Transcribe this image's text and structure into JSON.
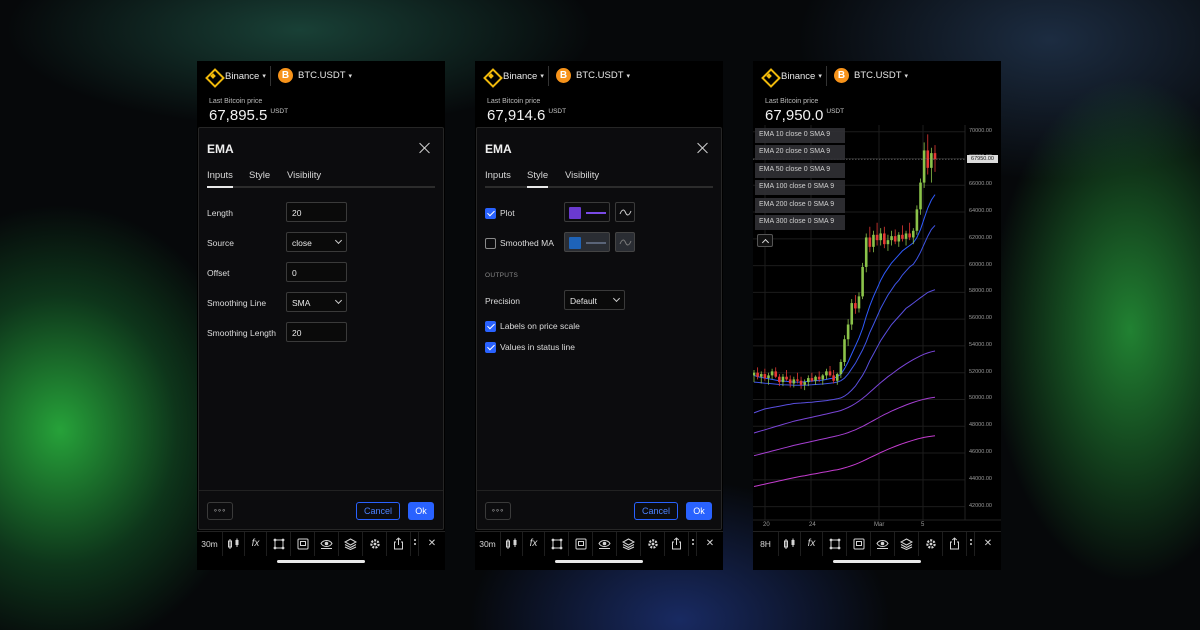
{
  "common": {
    "exchange": "Binance",
    "pair": "BTC.USDT",
    "btc_symbol": "B",
    "price_label": "Last Bitcoin price",
    "price_unit": "USDT",
    "caret": "▾"
  },
  "phones": [
    {
      "price": "67,895.5",
      "interval": "30m",
      "dialog": {
        "title": "EMA",
        "tabs": [
          "Inputs",
          "Style",
          "Visibility"
        ],
        "active_tab": "Inputs",
        "inputs": [
          {
            "label": "Length",
            "value": "20",
            "type": "number"
          },
          {
            "label": "Source",
            "value": "close",
            "type": "select"
          },
          {
            "label": "Offset",
            "value": "0",
            "type": "number"
          },
          {
            "label": "Smoothing Line",
            "value": "SMA",
            "type": "select"
          },
          {
            "label": "Smoothing Length",
            "value": "20",
            "type": "number"
          }
        ],
        "more_label": "◦◦◦",
        "cancel_label": "Cancel",
        "ok_label": "Ok"
      }
    },
    {
      "price": "67,914.6",
      "interval": "30m",
      "dialog": {
        "title": "EMA",
        "tabs": [
          "Inputs",
          "Style",
          "Visibility"
        ],
        "active_tab": "Style",
        "plot": {
          "label": "Plot",
          "checked": true,
          "color": "#6a3ad0",
          "line_color": "#7a4ae6"
        },
        "smoothed": {
          "label": "Smoothed MA",
          "checked": false,
          "color": "#1e63b8",
          "line_color": "#5a6478"
        },
        "outputs_caption": "OUTPUTS",
        "precision_label": "Precision",
        "precision_value": "Default",
        "labels_on_scale": "Labels on price scale",
        "values_in_status": "Values in status line",
        "more_label": "◦◦◦",
        "cancel_label": "Cancel",
        "ok_label": "Ok"
      }
    },
    {
      "price": "67,950.0",
      "interval": "8H",
      "legend": [
        "EMA 10 close 0 SMA 9",
        "EMA 20 close 0 SMA 9",
        "EMA 50 close 0 SMA 9",
        "EMA 100 close 0 SMA 9",
        "EMA 200 close 0 SMA 9",
        "EMA 300 close 0 SMA 9"
      ],
      "current_price_tag": "67950.00"
    }
  ],
  "toolbar": {
    "fx_label": "fx",
    "close_label": "✕"
  },
  "colors": {
    "accent": "#2962ff",
    "up_candle": "#8bc34a",
    "down_candle": "#e53935",
    "ema_colors": [
      "#2f5bff",
      "#3f55e8",
      "#5a4fe0",
      "#7a45d8",
      "#a63fd2",
      "#c43ccf"
    ]
  },
  "chart_data": {
    "type": "candlestick",
    "y_ticks": [
      "70000.00",
      "68000.00",
      "66000.00",
      "64000.00",
      "62000.00",
      "60000.00",
      "58000.00",
      "56000.00",
      "54000.00",
      "52000.00",
      "50000.00",
      "48000.00",
      "46000.00",
      "44000.00",
      "42000.00"
    ],
    "ylim": [
      41000,
      70500
    ],
    "x_ticks": [
      "20",
      "24",
      "Mar",
      "5"
    ],
    "grid": true,
    "candles": [
      [
        51800,
        52200,
        51300,
        52000
      ],
      [
        52000,
        52400,
        51500,
        51700
      ],
      [
        51700,
        52100,
        51200,
        51900
      ],
      [
        51900,
        52300,
        51400,
        51600
      ],
      [
        51600,
        52000,
        51100,
        51800
      ],
      [
        51800,
        52300,
        51500,
        52100
      ],
      [
        52100,
        52400,
        51600,
        51700
      ],
      [
        51700,
        51900,
        51000,
        51300
      ],
      [
        51300,
        51900,
        51000,
        51700
      ],
      [
        51700,
        52200,
        51400,
        51500
      ],
      [
        51500,
        51800,
        50900,
        51200
      ],
      [
        51200,
        51700,
        50900,
        51500
      ],
      [
        51500,
        52000,
        51200,
        51400
      ],
      [
        51400,
        51700,
        50800,
        51100
      ],
      [
        51100,
        51500,
        50700,
        51300
      ],
      [
        51300,
        51800,
        51000,
        51600
      ],
      [
        51600,
        52000,
        51300,
        51400
      ],
      [
        51400,
        51800,
        51100,
        51700
      ],
      [
        51700,
        52100,
        51300,
        51500
      ],
      [
        51500,
        51900,
        51100,
        51800
      ],
      [
        51800,
        52300,
        51500,
        52100
      ],
      [
        52100,
        52500,
        51700,
        51800
      ],
      [
        51800,
        52200,
        51200,
        51400
      ],
      [
        51400,
        52000,
        51100,
        51900
      ],
      [
        51900,
        53000,
        51600,
        52800
      ],
      [
        52800,
        54800,
        52500,
        54500
      ],
      [
        54500,
        56000,
        54000,
        55600
      ],
      [
        55600,
        57500,
        55200,
        57200
      ],
      [
        57200,
        57800,
        56400,
        56800
      ],
      [
        56800,
        58000,
        56500,
        57700
      ],
      [
        57700,
        60200,
        57500,
        59900
      ],
      [
        59900,
        62400,
        59500,
        62100
      ],
      [
        62100,
        62900,
        61000,
        61400
      ],
      [
        61400,
        62600,
        61000,
        62300
      ],
      [
        62300,
        63200,
        61500,
        61900
      ],
      [
        61900,
        62800,
        61500,
        62400
      ],
      [
        62400,
        62900,
        61300,
        61600
      ],
      [
        61600,
        62300,
        61100,
        61900
      ],
      [
        61900,
        62600,
        61500,
        62200
      ],
      [
        62200,
        62700,
        61600,
        61800
      ],
      [
        61800,
        62500,
        61400,
        62300
      ],
      [
        62300,
        63000,
        61800,
        62000
      ],
      [
        62000,
        62600,
        61500,
        62400
      ],
      [
        62400,
        63200,
        61900,
        62100
      ],
      [
        62100,
        62800,
        61600,
        62600
      ],
      [
        62600,
        64500,
        62300,
        64200
      ],
      [
        64200,
        66500,
        63800,
        66200
      ],
      [
        66200,
        69200,
        65800,
        68600
      ],
      [
        68600,
        69800,
        66800,
        67300
      ],
      [
        67300,
        68800,
        66200,
        68400
      ],
      [
        68400,
        69000,
        67000,
        67950
      ]
    ],
    "ema_series": [
      {
        "values": [
          51800,
          51700,
          51650,
          51600,
          51550,
          51500,
          51450,
          51400,
          51380,
          51350,
          51320,
          51300,
          51300,
          51300,
          51320,
          51350,
          51380,
          51400,
          51420,
          51450,
          51500,
          51560,
          51600,
          51700,
          51900,
          52300,
          52800,
          53400,
          54000,
          54600,
          55300,
          56200,
          57000,
          57700,
          58300,
          58900,
          59400,
          59800,
          60200,
          60500,
          60800,
          61100,
          61300,
          61500,
          61700,
          62100,
          62700,
          63500,
          64300,
          64900,
          65300
        ]
      },
      {
        "values": [
          51300,
          51280,
          51250,
          51220,
          51200,
          51180,
          51150,
          51120,
          51100,
          51090,
          51080,
          51070,
          51060,
          51060,
          51070,
          51080,
          51100,
          51120,
          51140,
          51160,
          51190,
          51220,
          51250,
          51300,
          51400,
          51600,
          51900,
          52300,
          52700,
          53200,
          53700,
          54300,
          55000,
          55600,
          56200,
          56800,
          57300,
          57800,
          58200,
          58600,
          58900,
          59300,
          59600,
          59900,
          60100,
          60500,
          61000,
          61600,
          62200,
          62700,
          63000
        ]
      },
      {
        "values": [
          49000,
          49100,
          49200,
          49300,
          49350,
          49400,
          49450,
          49500,
          49550,
          49600,
          49650,
          49700,
          49720,
          49740,
          49760,
          49780,
          49800,
          49830,
          49860,
          49890,
          49920,
          49960,
          50000,
          50050,
          50120,
          50250,
          50450,
          50700,
          51000,
          51400,
          51800,
          52300,
          52900,
          53400,
          53900,
          54400,
          54800,
          55200,
          55600,
          55900,
          56200,
          56500,
          56800,
          57000,
          57200,
          57400,
          57600,
          57800,
          58000,
          58100,
          58200
        ]
      },
      {
        "values": [
          47500,
          47580,
          47660,
          47740,
          47820,
          47900,
          47980,
          48060,
          48140,
          48220,
          48300,
          48380,
          48440,
          48500,
          48560,
          48620,
          48680,
          48740,
          48800,
          48860,
          48920,
          48980,
          49040,
          49100,
          49180,
          49280,
          49400,
          49540,
          49700,
          49880,
          50080,
          50300,
          50540,
          50780,
          51020,
          51260,
          51480,
          51700,
          51900,
          52100,
          52300,
          52480,
          52660,
          52820,
          52980,
          53120,
          53260,
          53380,
          53480,
          53560,
          53620
        ]
      },
      {
        "values": [
          45800,
          45870,
          45940,
          46010,
          46080,
          46150,
          46220,
          46290,
          46360,
          46430,
          46500,
          46570,
          46630,
          46690,
          46750,
          46810,
          46870,
          46930,
          46990,
          47050,
          47110,
          47170,
          47230,
          47290,
          47360,
          47440,
          47530,
          47630,
          47740,
          47860,
          47990,
          48130,
          48280,
          48430,
          48580,
          48730,
          48870,
          49000,
          49130,
          49250,
          49370,
          49480,
          49590,
          49690,
          49780,
          49870,
          49950,
          50020,
          50080,
          50130,
          50170
        ]
      },
      {
        "values": [
          43500,
          43560,
          43620,
          43680,
          43740,
          43800,
          43860,
          43920,
          43980,
          44040,
          44100,
          44160,
          44210,
          44260,
          44310,
          44360,
          44410,
          44460,
          44510,
          44560,
          44610,
          44660,
          44710,
          44760,
          44820,
          44890,
          44970,
          45060,
          45160,
          45270,
          45390,
          45520,
          45650,
          45780,
          45910,
          46040,
          46160,
          46280,
          46390,
          46500,
          46600,
          46700,
          46790,
          46880,
          46960,
          47040,
          47110,
          47170,
          47220,
          47260,
          47290
        ]
      }
    ]
  }
}
